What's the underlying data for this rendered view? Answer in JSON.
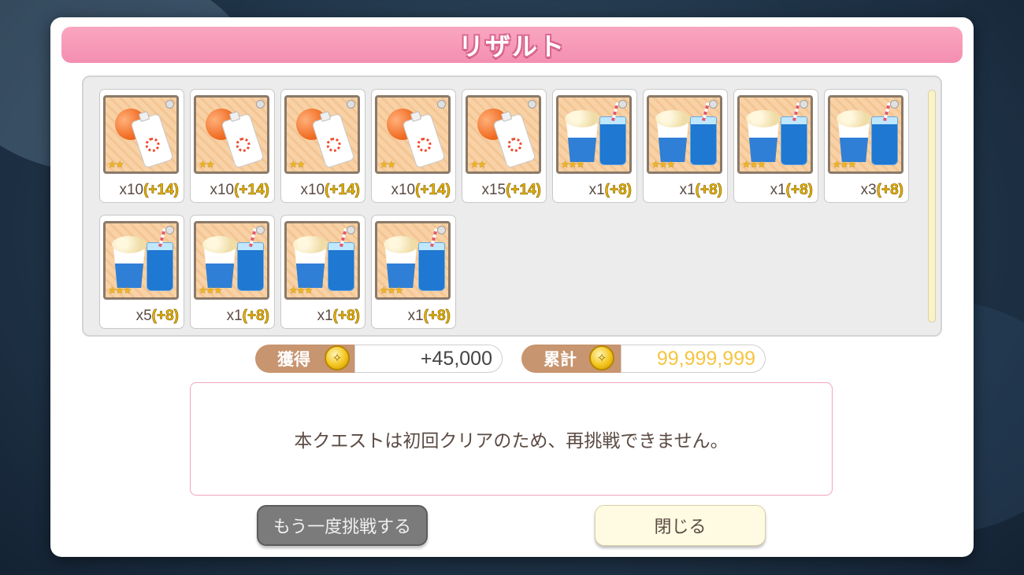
{
  "dialog": {
    "title": "リザルト"
  },
  "rewards": [
    {
      "type": "sunscreen",
      "stars": "★★",
      "qty": "x10",
      "bonus": "(+14)"
    },
    {
      "type": "sunscreen",
      "stars": "★★",
      "qty": "x10",
      "bonus": "(+14)"
    },
    {
      "type": "sunscreen",
      "stars": "★★",
      "qty": "x10",
      "bonus": "(+14)"
    },
    {
      "type": "sunscreen",
      "stars": "★★",
      "qty": "x10",
      "bonus": "(+14)"
    },
    {
      "type": "sunscreen",
      "stars": "★★",
      "qty": "x15",
      "bonus": "(+14)"
    },
    {
      "type": "popcorn",
      "stars": "★★★",
      "qty": "x1",
      "bonus": "(+8)"
    },
    {
      "type": "popcorn",
      "stars": "★★★",
      "qty": "x1",
      "bonus": "(+8)"
    },
    {
      "type": "popcorn",
      "stars": "★★★",
      "qty": "x1",
      "bonus": "(+8)"
    },
    {
      "type": "popcorn",
      "stars": "★★★",
      "qty": "x3",
      "bonus": "(+8)"
    },
    {
      "type": "popcorn",
      "stars": "★★★",
      "qty": "x5",
      "bonus": "(+8)"
    },
    {
      "type": "popcorn",
      "stars": "★★★",
      "qty": "x1",
      "bonus": "(+8)"
    },
    {
      "type": "popcorn",
      "stars": "★★★",
      "qty": "x1",
      "bonus": "(+8)"
    },
    {
      "type": "popcorn",
      "stars": "★★★",
      "qty": "x1",
      "bonus": "(+8)"
    }
  ],
  "earned": {
    "label": "獲得",
    "value": "+45,000",
    "icon": "coin-icon"
  },
  "total": {
    "label": "累計",
    "value": "99,999,999",
    "icon": "coin-icon",
    "value_color": "#f5c542"
  },
  "message": "本クエストは初回クリアのため、再挑戦できません。",
  "buttons": {
    "retry": "もう一度挑戦する",
    "close": "閉じる"
  },
  "colors": {
    "title_bar": "#f48fb1",
    "stat_label": "#c79570",
    "bonus_text": "#e8b400"
  }
}
